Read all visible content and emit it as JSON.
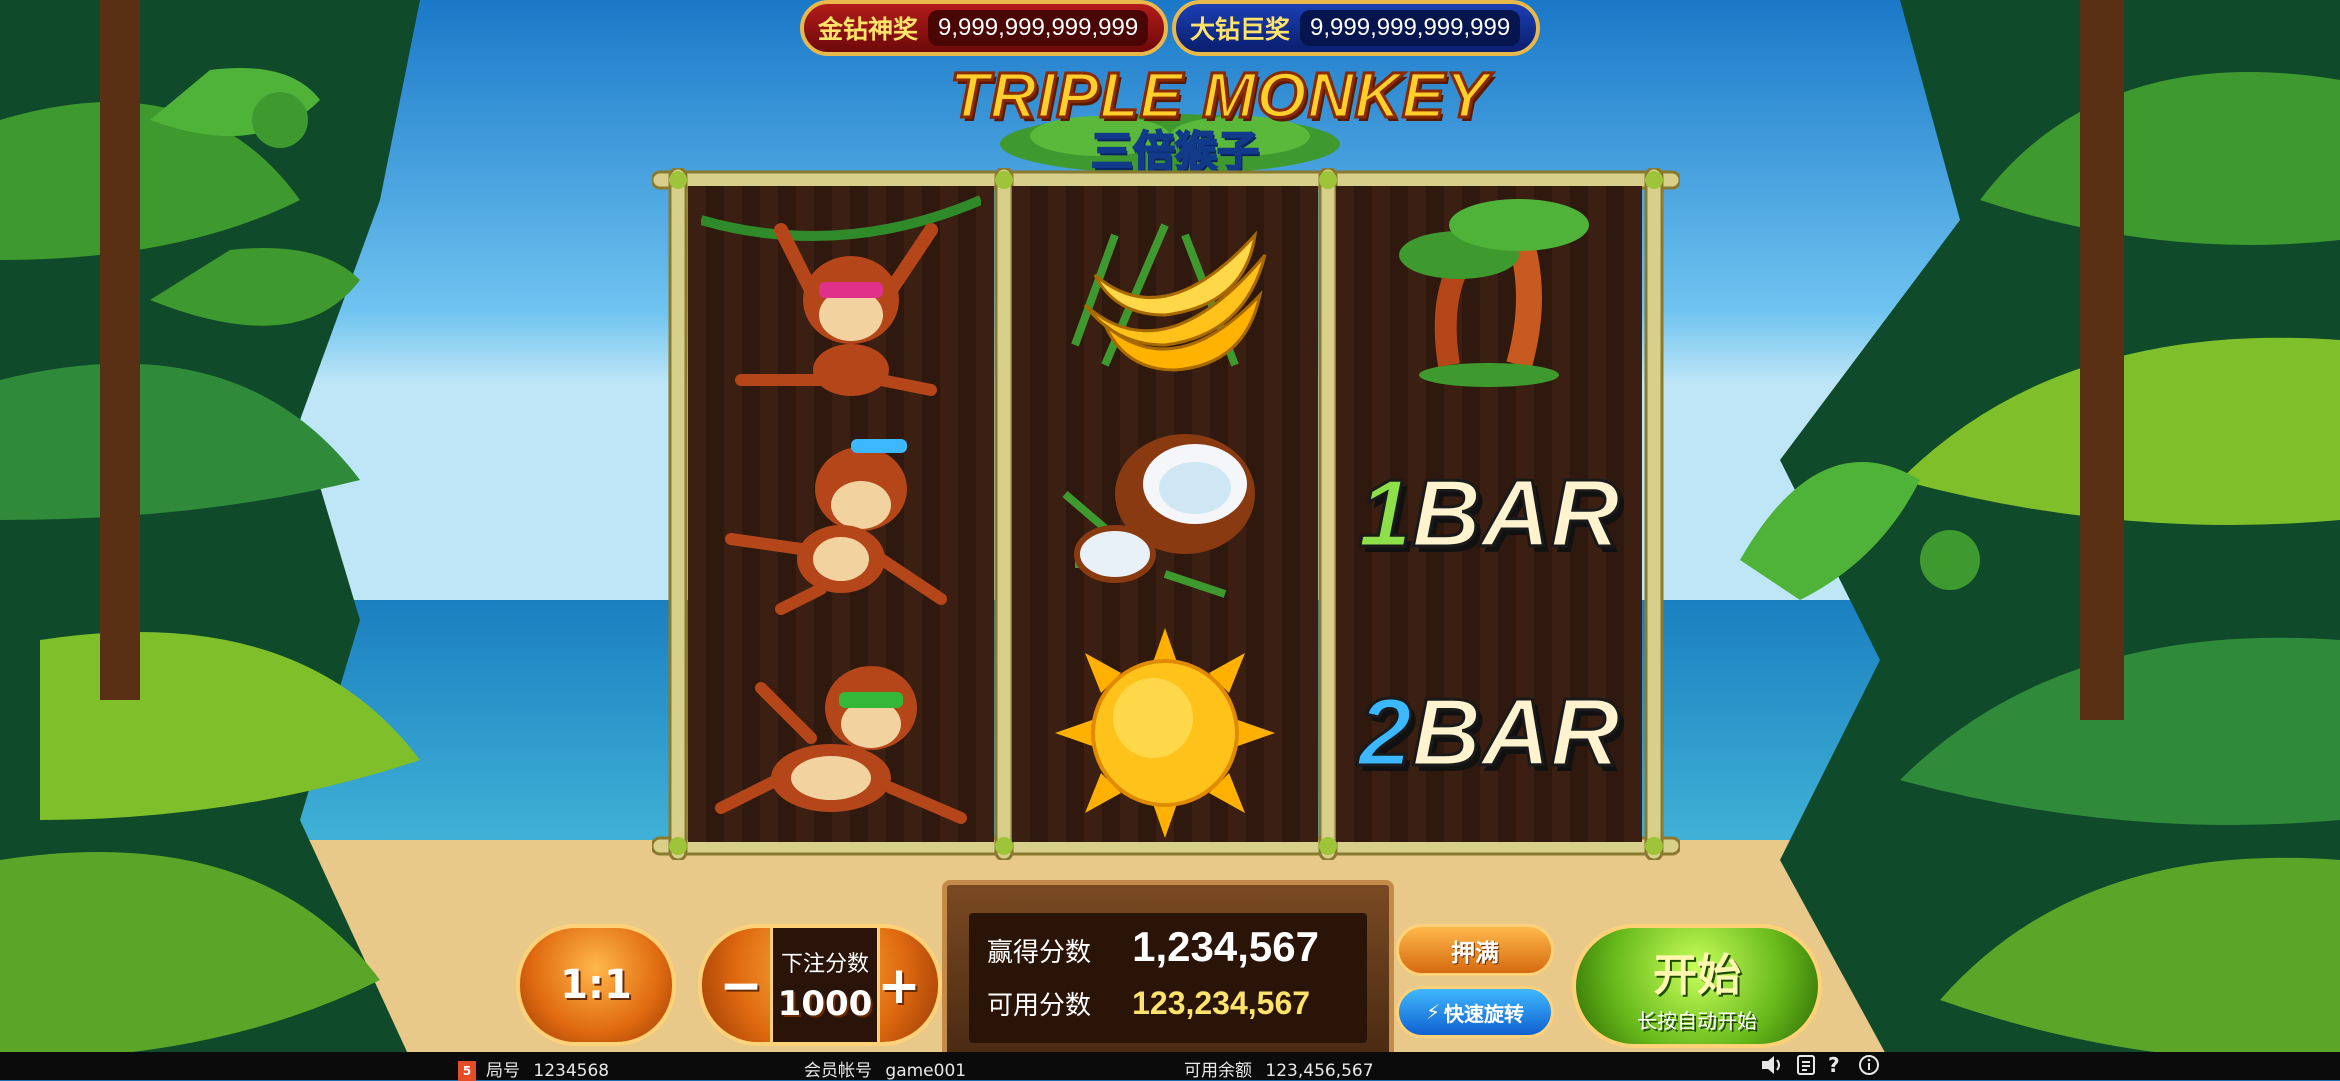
{
  "jackpots": {
    "gold": {
      "label": "金钻神奖",
      "value": "9,999,999,999,999"
    },
    "blue": {
      "label": "大钻巨奖",
      "value": "9,999,999,999,999"
    }
  },
  "logo": {
    "title": "TRIPLE MONKEY",
    "subtitle": "三倍猴子"
  },
  "reels": [
    {
      "symbols": [
        "monkey-pink-glasses",
        "monkey-blue-glasses",
        "monkey-green-glasses"
      ]
    },
    {
      "symbols": [
        "banana",
        "coconut",
        "sun"
      ]
    },
    {
      "symbols": [
        "palm-trees",
        "1-bar",
        "2-bar"
      ]
    }
  ],
  "bar_symbols": {
    "one": {
      "num": "1",
      "bar": "BAR"
    },
    "two": {
      "num": "2",
      "bar": "BAR"
    }
  },
  "controls": {
    "ratio": "1:1",
    "bet_label": "下注分数",
    "bet_value": "1000",
    "minus": "−",
    "plus": "+",
    "max_bet": "押满",
    "quick_spin": "快速旋转",
    "start": "开始",
    "start_sub": "长按自动开始"
  },
  "score": {
    "win_label": "赢得分数",
    "win_value": "1,234,567",
    "credit_label": "可用分数",
    "credit_value": "123,234,567"
  },
  "status": {
    "round_label": "局号",
    "round_value": "1234568",
    "member_label": "会员帐号",
    "member_value": "game001",
    "balance_label": "可用余额",
    "balance_value": "123,456,567",
    "h5_badge": "5"
  },
  "icons": [
    "sound-icon",
    "paytable-icon",
    "help-icon",
    "info-icon"
  ]
}
